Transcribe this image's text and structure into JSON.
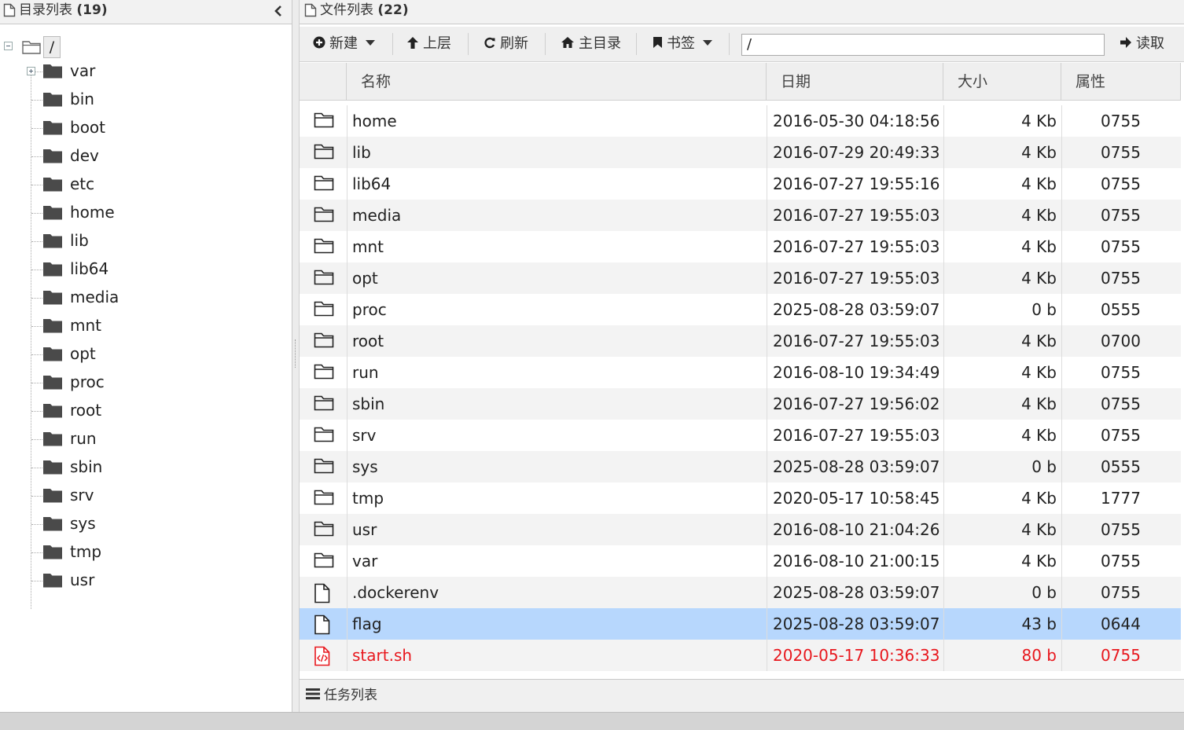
{
  "left_panel": {
    "title": "目录列表",
    "count": "(19)",
    "root_label": "/",
    "tree": [
      {
        "label": "var",
        "expandable": true
      },
      {
        "label": "bin"
      },
      {
        "label": "boot"
      },
      {
        "label": "dev"
      },
      {
        "label": "etc"
      },
      {
        "label": "home"
      },
      {
        "label": "lib"
      },
      {
        "label": "lib64"
      },
      {
        "label": "media"
      },
      {
        "label": "mnt"
      },
      {
        "label": "opt"
      },
      {
        "label": "proc"
      },
      {
        "label": "root"
      },
      {
        "label": "run"
      },
      {
        "label": "sbin"
      },
      {
        "label": "srv"
      },
      {
        "label": "sys"
      },
      {
        "label": "tmp"
      },
      {
        "label": "usr"
      }
    ]
  },
  "right_panel": {
    "title": "文件列表",
    "count": "(22)",
    "toolbar": {
      "new_label": "新建",
      "up_label": "上层",
      "refresh_label": "刷新",
      "home_label": "主目录",
      "bookmark_label": "书签",
      "path_value": "/",
      "read_label": "读取"
    },
    "columns": {
      "name": "名称",
      "date": "日期",
      "size": "大小",
      "attr": "属性"
    },
    "rows": [
      {
        "type": "folder",
        "name": "home",
        "date": "2016-05-30 04:18:56",
        "size": "4 Kb",
        "attr": "0755"
      },
      {
        "type": "folder",
        "name": "lib",
        "date": "2016-07-29 20:49:33",
        "size": "4 Kb",
        "attr": "0755"
      },
      {
        "type": "folder",
        "name": "lib64",
        "date": "2016-07-27 19:55:16",
        "size": "4 Kb",
        "attr": "0755"
      },
      {
        "type": "folder",
        "name": "media",
        "date": "2016-07-27 19:55:03",
        "size": "4 Kb",
        "attr": "0755"
      },
      {
        "type": "folder",
        "name": "mnt",
        "date": "2016-07-27 19:55:03",
        "size": "4 Kb",
        "attr": "0755"
      },
      {
        "type": "folder",
        "name": "opt",
        "date": "2016-07-27 19:55:03",
        "size": "4 Kb",
        "attr": "0755"
      },
      {
        "type": "folder",
        "name": "proc",
        "date": "2025-08-28 03:59:07",
        "size": "0 b",
        "attr": "0555"
      },
      {
        "type": "folder",
        "name": "root",
        "date": "2016-07-27 19:55:03",
        "size": "4 Kb",
        "attr": "0700"
      },
      {
        "type": "folder",
        "name": "run",
        "date": "2016-08-10 19:34:49",
        "size": "4 Kb",
        "attr": "0755"
      },
      {
        "type": "folder",
        "name": "sbin",
        "date": "2016-07-27 19:56:02",
        "size": "4 Kb",
        "attr": "0755"
      },
      {
        "type": "folder",
        "name": "srv",
        "date": "2016-07-27 19:55:03",
        "size": "4 Kb",
        "attr": "0755"
      },
      {
        "type": "folder",
        "name": "sys",
        "date": "2025-08-28 03:59:07",
        "size": "0 b",
        "attr": "0555"
      },
      {
        "type": "folder",
        "name": "tmp",
        "date": "2020-05-17 10:58:45",
        "size": "4 Kb",
        "attr": "1777"
      },
      {
        "type": "folder",
        "name": "usr",
        "date": "2016-08-10 21:04:26",
        "size": "4 Kb",
        "attr": "0755"
      },
      {
        "type": "folder",
        "name": "var",
        "date": "2016-08-10 21:00:15",
        "size": "4 Kb",
        "attr": "0755"
      },
      {
        "type": "file",
        "name": ".dockerenv",
        "date": "2025-08-28 03:59:07",
        "size": "0 b",
        "attr": "0755"
      },
      {
        "type": "file",
        "name": "flag",
        "date": "2025-08-28 03:59:07",
        "size": "43 b",
        "attr": "0644",
        "selected": true
      },
      {
        "type": "script",
        "name": "start.sh",
        "date": "2020-05-17 10:36:33",
        "size": "80 b",
        "attr": "0755",
        "highlight": "red"
      }
    ]
  },
  "task_bar": {
    "title": "任务列表"
  },
  "icons": {
    "left_header": "document-icon",
    "collapse": "chevron-left-icon",
    "tree_folder": "folder-filled-icon",
    "row_folder": "folder-outline-icon",
    "row_file": "file-outline-icon",
    "row_script": "code-file-icon",
    "new": "plus-circle-icon",
    "up": "arrow-up-icon",
    "refresh": "refresh-icon",
    "home": "home-icon",
    "bookmark": "bookmark-icon",
    "read": "arrow-right-icon",
    "tasks": "list-icon"
  },
  "colors": {
    "selected_row": "#b7d7fd",
    "red_text": "#e8171d"
  }
}
